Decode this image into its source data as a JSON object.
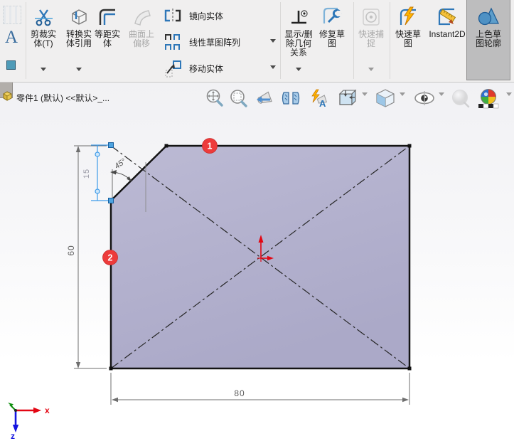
{
  "ribbon": {
    "text_tool_glyph": "A",
    "trim_label": "剪裁实体(T)",
    "convert_label": "转换实体引用",
    "offset_label": "等距实体",
    "surface_offset_label": "曲面上偏移",
    "mirror_label": "镜向实体",
    "linear_pattern_label": "线性草图阵列",
    "move_label": "移动实体",
    "relations_label": "显示/删除几何关系",
    "repair_label": "修复草图",
    "quick_snaps_label": "快速捕捉",
    "rapid_sketch_label": "快速草图",
    "instant2d_label": "Instant2D",
    "shaded_contours_label": "上色草图轮廓"
  },
  "viewport": {
    "part_label": "零件1 (默认) <<默认>_...",
    "annotation_glyph": "A"
  },
  "sketch": {
    "dim_width": "80",
    "dim_height": "60",
    "dim_chamfer": "15",
    "dim_angle": "45°",
    "balloons": [
      {
        "label": "1"
      },
      {
        "label": "2"
      }
    ]
  },
  "triad": {
    "x": "x",
    "z": "z"
  },
  "colors": {
    "face": "#b3b1ce",
    "selection_blue": "#3d9be9",
    "balloon_red": "#ed3b3b",
    "origin_red": "#e30613",
    "accent_blue": "#2e77b8"
  }
}
